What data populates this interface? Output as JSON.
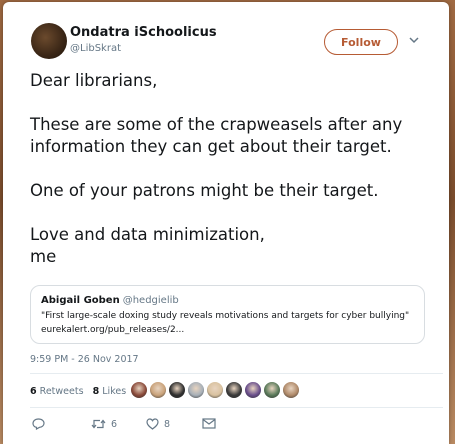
{
  "colors": {
    "follow_accent": "#b65b34",
    "text_primary": "#14171a",
    "text_secondary": "#657786",
    "border": "#d8dde1"
  },
  "author": {
    "name": "Ondatra iSchoolicus",
    "handle": "@LibSkrat",
    "avatar_icon": "profile-photo"
  },
  "follow_button": {
    "label": "Follow"
  },
  "menu": {
    "icon": "chevron-down-icon"
  },
  "tweet": {
    "lines": [
      "Dear librarians,",
      "",
      "These are some of the crapweasels after any",
      "information they can get about their target.",
      "",
      "One of your patrons might be their target.",
      "",
      "Love and data minimization,",
      "me"
    ]
  },
  "quoted_tweet": {
    "author_name": "Abigail Goben",
    "author_handle": "@hedgielib",
    "text": "\"First large-scale doxing study reveals motivations and targets for cyber bullying\"",
    "link": "eurekalert.org/pub_releases/2..."
  },
  "timestamp": "9:59 PM - 26 Nov 2017",
  "stats": {
    "retweets_count": "6",
    "retweets_label": "Retweets",
    "likes_count": "8",
    "likes_label": "Likes",
    "liker_avatars": [
      "#8a4a3a",
      "#c9a27a",
      "#2f2f2f",
      "#a8b0b8",
      "#d9c2a0",
      "#3b3b3b",
      "#6a4f8c",
      "#5a7a5a",
      "#b08a6a"
    ]
  },
  "actions": {
    "reply_icon": "reply-icon",
    "retweet_icon": "retweet-icon",
    "retweet_count": "6",
    "like_icon": "heart-icon",
    "like_count": "8",
    "message_icon": "envelope-icon"
  }
}
